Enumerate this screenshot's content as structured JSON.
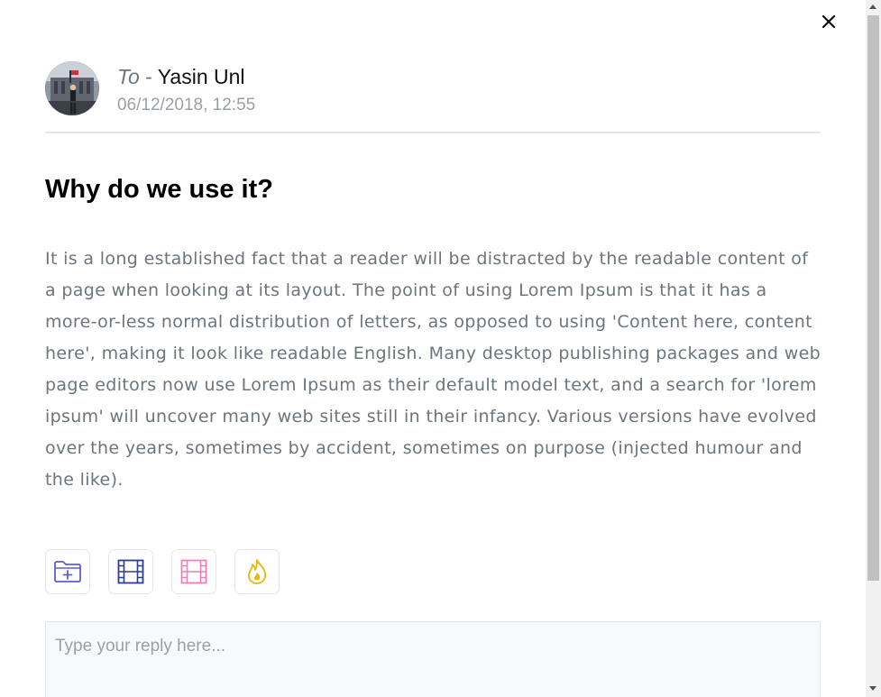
{
  "header": {
    "to_prefix": "To",
    "dash": "-",
    "recipient": "Yasin Unl",
    "date": "06/12/2018, 12:55"
  },
  "message": {
    "subject": "Why do we use it?",
    "body": "It is a long established fact that a reader will be distracted by the readable content of a page when looking at its layout. The point of using Lorem Ipsum is that it has a more-or-less normal distribution of letters, as opposed to using 'Content here, content here', making it look like readable English. Many desktop publishing packages and web page editors now use Lorem Ipsum as their default model text, and a search for 'lorem ipsum' will uncover many web sites still in their infancy. Various versions have evolved over the years, sometimes by accident, sometimes on purpose (injected humour and the like)."
  },
  "attachments": [
    {
      "icon": "folder-plus-icon",
      "color": "#5b5fd6"
    },
    {
      "icon": "film-icon",
      "color": "#2c3e8f"
    },
    {
      "icon": "film-icon",
      "color": "#f17fb7"
    },
    {
      "icon": "fire-icon",
      "color": "#e8b80c"
    }
  ],
  "reply": {
    "placeholder": "Type your reply here..."
  },
  "colors": {
    "border": "#e4e6ea",
    "text_muted": "#6c757d",
    "date": "#9aa0a6"
  }
}
